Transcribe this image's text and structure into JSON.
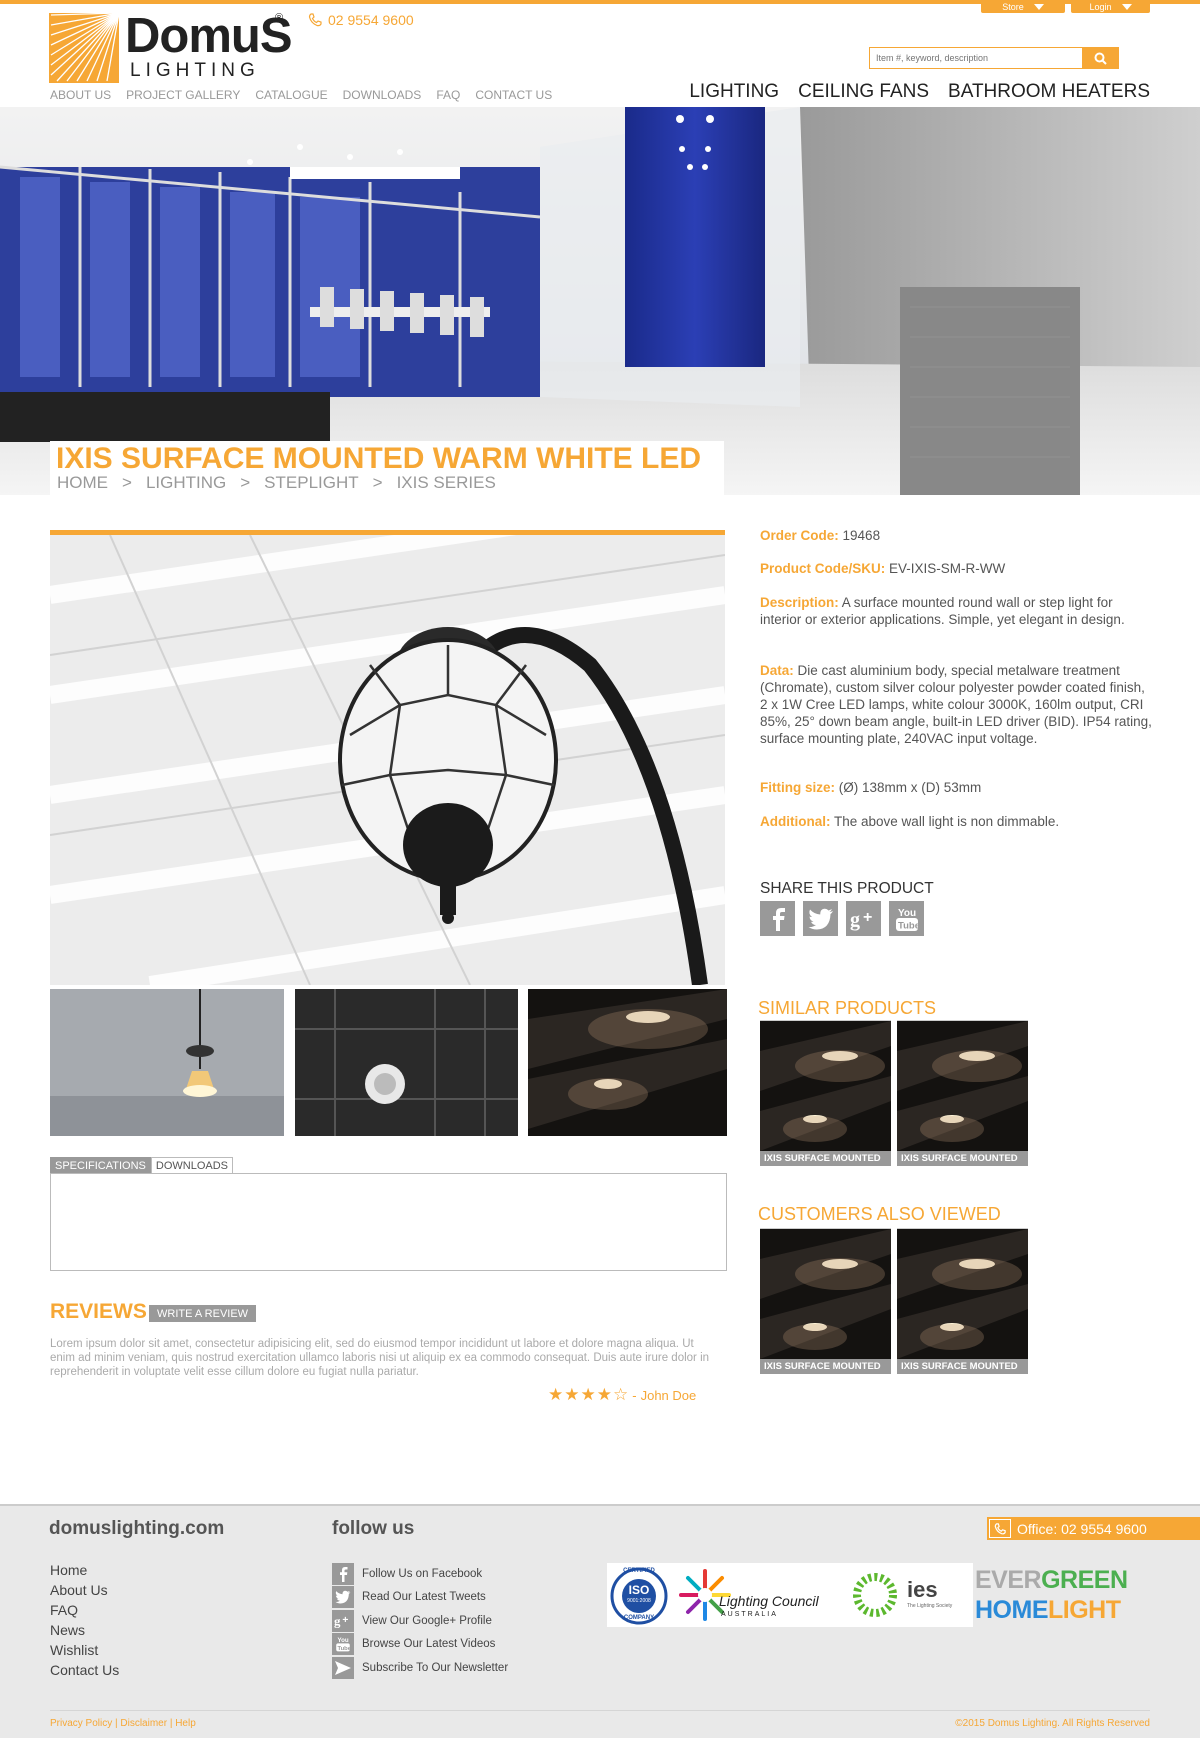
{
  "header": {
    "store_label": "Store",
    "login_label": "Login",
    "logo_text": "DomuS",
    "logo_sub": "LIGHTING",
    "logo_reg": "®",
    "phone": "02 9554 9600",
    "search_placeholder": "Item #, keyword, description",
    "nav": [
      "ABOUT US",
      "PROJECT GALLERY",
      "CATALOGUE",
      "DOWNLOADS",
      "FAQ",
      "CONTACT US"
    ],
    "main_nav": [
      "LIGHTING",
      "CEILING FANS",
      "BATHROOM HEATERS"
    ]
  },
  "product": {
    "title": "IXIS SURFACE MOUNTED WARM WHITE LED",
    "breadcrumb": [
      "HOME",
      ">",
      "LIGHTING",
      ">",
      "STEPLIGHT",
      ">",
      "IXIS SERIES"
    ],
    "order_code_label": "Order Code:",
    "order_code": "19468",
    "sku_label": "Product Code/SKU:",
    "sku": "EV-IXIS-SM-R-WW",
    "description_label": "Description:",
    "description": "A surface mounted round wall or step light for interior or exterior applications. Simple, yet elegant in design.",
    "data_label": "Data:",
    "data": "Die cast aluminium body, special metalware treat­ment (Chromate), custom silver colour polyester powder coated finish, 2 x 1W Cree LED lamps, white colour 3000K, 160lm output, CRI 85%, 25° down beam angle, built-in LED driver (BID). IP54 rating, surface mounting plate, 240VAC input voltage.",
    "fitting_label": "Fitting size:",
    "fitting": "(Ø) 138mm x (D) 53mm",
    "additional_label": "Additional:",
    "additional": "The above wall light is non dimmable."
  },
  "tabs": [
    "SPECIFICATIONS",
    "DOWNLOADS"
  ],
  "reviews": {
    "heading": "REVIEWS",
    "write_label": "WRITE A REVIEW",
    "text": "Lorem ipsum dolor sit amet, consectetur adipisicing elit, sed do eiusmod tempor incididunt ut labore et dolore magna aliqua. Ut enim ad minim veniam, quis nostrud exercitation ullamco laboris nisi ut aliquip ex ea commodo consequat. Duis aute irure dolor in reprehenderit in voluptate velit esse cillum dolore eu fugiat nulla pariatur.",
    "stars": 4,
    "stars_max": 5,
    "sep": "-",
    "author": "John Doe"
  },
  "share": {
    "heading": "SHARE THIS PRODUCT",
    "icons": [
      "facebook-icon",
      "twitter-icon",
      "google-plus-icon",
      "youtube-icon"
    ]
  },
  "similar": {
    "heading": "SIMILAR PRODUCTS",
    "items": [
      "IXIS SURFACE MOUNTED",
      "IXIS SURFACE MOUNTED"
    ]
  },
  "also_viewed": {
    "heading": "CUSTOMERS ALSO VIEWED",
    "items": [
      "IXIS SURFACE MOUNTED",
      "IXIS SURFACE MOUNTED"
    ]
  },
  "footer": {
    "site": "domuslighting.com",
    "links": [
      "Home",
      "About Us",
      "FAQ",
      "News",
      "Wishlist",
      "Contact Us"
    ],
    "follow_heading": "follow us",
    "follow": [
      "Follow Us on Facebook",
      "Read Our Latest Tweets",
      "View Our Google+ Profile",
      "Browse Our Latest Videos",
      "Subscribe To Our Newsletter"
    ],
    "office": "Office: 02 9554 9600",
    "partner_iso": "ISO",
    "partner_iso_top": "CERTIFIED",
    "partner_iso_num": "9001:2008",
    "partner_iso_bottom": "COMPANY",
    "partner_lc": "Lighting Council",
    "partner_lc_sub": "AUSTRALIA",
    "partner_ies": "ies",
    "partner_ies_sub": "The Lighting Society",
    "evergreen_a": "EVER",
    "evergreen_b": "GREEN",
    "homelight_a": "HOME",
    "homelight_b": "LIGHT",
    "legal": "Privacy Policy | Disclaimer | Help",
    "copyright": "©2015 Domus Lighting. All Rights Reserved"
  },
  "colors": {
    "accent": "#f6a735",
    "grey": "#999999"
  }
}
